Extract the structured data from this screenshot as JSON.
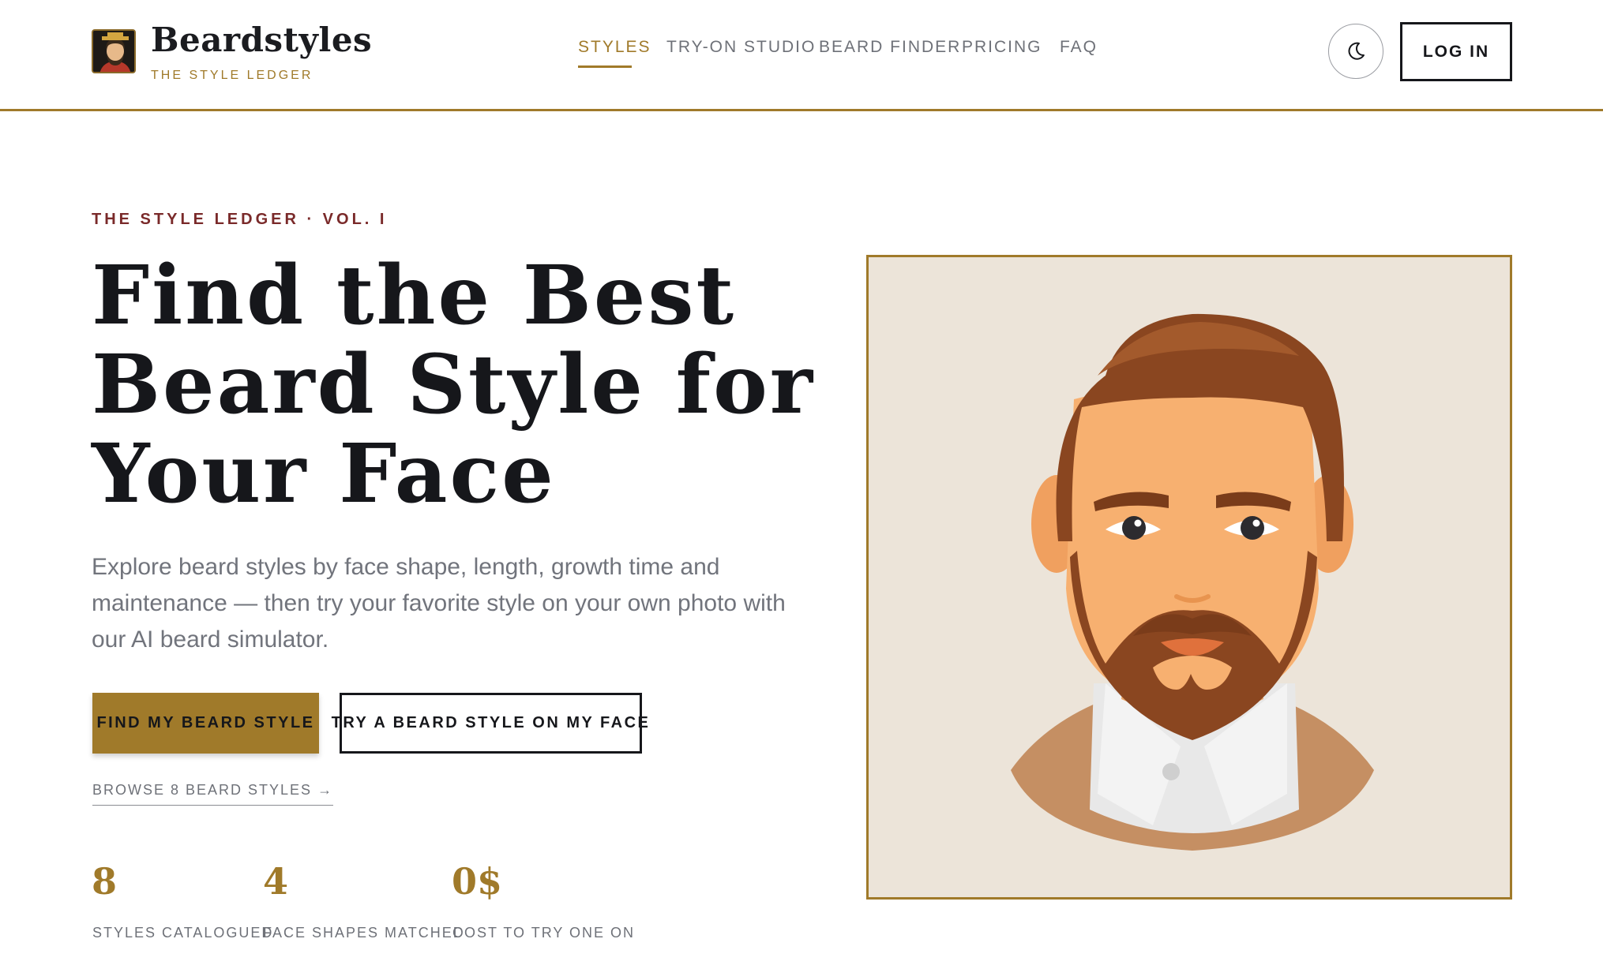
{
  "header": {
    "brand_name": "Beardstyles",
    "brand_tagline": "THE STYLE LEDGER",
    "nav": [
      {
        "label": "STYLES",
        "active": true
      },
      {
        "label": "TRY-ON STUDIO",
        "active": false
      },
      {
        "label": "BEARD FINDER",
        "active": false
      },
      {
        "label": "PRICING",
        "active": false
      },
      {
        "label": "FAQ",
        "active": false
      }
    ],
    "theme_toggle_icon": "moon-icon",
    "login_label": "LOG IN"
  },
  "hero": {
    "eyebrow": "THE STYLE LEDGER · VOL. I",
    "title_lines": [
      "Find the Best",
      "Beard Style for",
      "Your Face"
    ],
    "description": "Explore beard styles by face shape, length, growth time and maintenance — then try your favorite style on your own photo with our AI beard simulator.",
    "primary_button": "FIND MY BEARD STYLE",
    "secondary_button": "TRY A BEARD STYLE ON MY FACE",
    "browse_link": "BROWSE 8 BEARD STYLES →",
    "stats": [
      {
        "value": "8",
        "label": "STYLES CATALOGUED"
      },
      {
        "value": "4",
        "label": "FACE SHAPES MATCHED"
      },
      {
        "value": "0$",
        "label": "COST TO TRY ONE ON"
      }
    ]
  },
  "colors": {
    "accent_gold": "#a07a2a",
    "ink": "#16171b",
    "eyebrow_red": "#7a2a2a",
    "muted_text": "#6e7178",
    "illustration_bg": "#ece4d9"
  }
}
